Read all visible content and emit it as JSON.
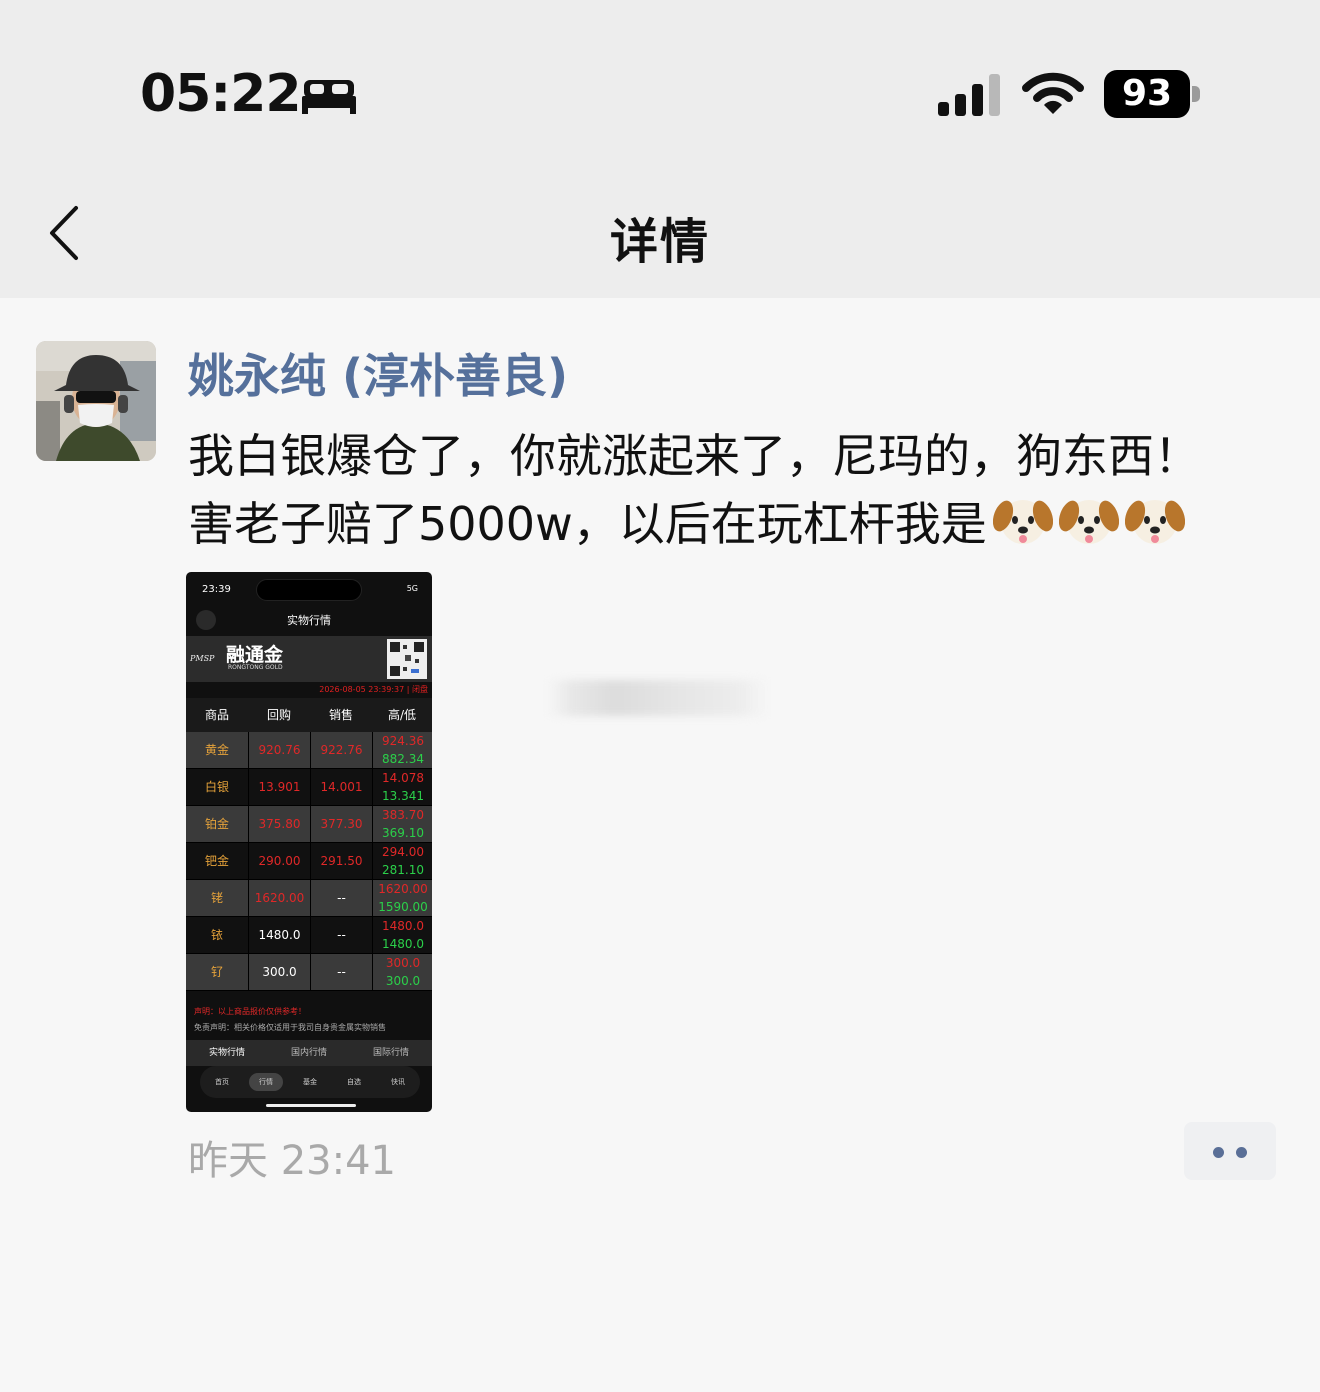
{
  "status_bar": {
    "time": "05:22",
    "battery": "93"
  },
  "nav": {
    "title": "详情"
  },
  "post": {
    "author": "姚永纯 (淳朴善良)",
    "line1": "我白银爆仓了，你就涨起来了，尼玛的，狗东西！",
    "line2": "害老子赔了5000w，以后在玩杠杆我是",
    "timestamp": "昨天 23:41"
  },
  "screenshot": {
    "time": "23:39",
    "network": "5G",
    "header": "实物行情",
    "brand": "融通金",
    "brand_sub": "RONGTONG GOLD",
    "brand_mark": "PMSP",
    "date": "2026-08-05 23:39:37 | 闭盘",
    "columns": [
      "商品",
      "回购",
      "销售",
      "高/低"
    ],
    "rows": [
      {
        "name": "黄金",
        "buy": "920.76",
        "sell": "922.76",
        "high": "924.36",
        "low": "882.34"
      },
      {
        "name": "白银",
        "buy": "13.901",
        "sell": "14.001",
        "high": "14.078",
        "low": "13.341"
      },
      {
        "name": "铂金",
        "buy": "375.80",
        "sell": "377.30",
        "high": "383.70",
        "low": "369.10"
      },
      {
        "name": "钯金",
        "buy": "290.00",
        "sell": "291.50",
        "high": "294.00",
        "low": "281.10"
      },
      {
        "name": "铑",
        "buy": "1620.00",
        "sell": "--",
        "high": "1620.00",
        "low": "1590.00"
      },
      {
        "name": "铱",
        "buy": "1480.0",
        "sell": "--",
        "high": "1480.0",
        "low": "1480.0"
      },
      {
        "name": "钌",
        "buy": "300.0",
        "sell": "--",
        "high": "300.0",
        "low": "300.0"
      }
    ],
    "note1": "声明：以上商品报价仅供参考！",
    "note2": "免责声明：相关价格仅适用于我司自身贵金属实物销售",
    "tabs": [
      "实物行情",
      "国内行情",
      "国际行情"
    ],
    "bottom_nav": [
      "首页",
      "行情",
      "基金",
      "自选",
      "快讯"
    ]
  },
  "colors": {
    "author": "#55709b",
    "buy_red": "#e02828",
    "low_green": "#2bd04a",
    "name_gold": "#e5a23a"
  }
}
